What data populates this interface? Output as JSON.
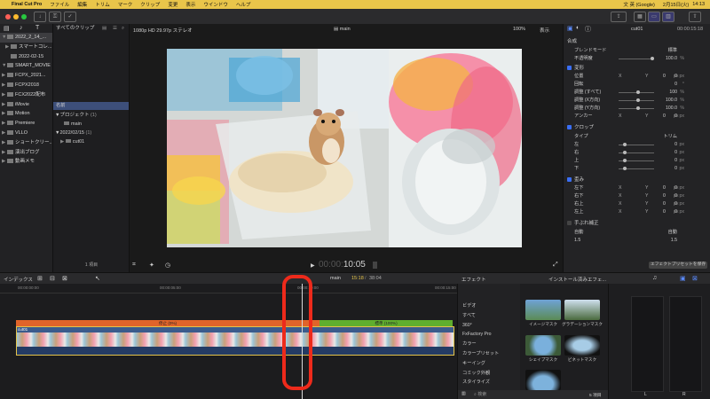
{
  "menubar": {
    "apple": "",
    "app": "Final Cut Pro",
    "items": [
      "ファイル",
      "編集",
      "トリム",
      "マーク",
      "クリップ",
      "変更",
      "表示",
      "ウインドウ",
      "ヘルプ"
    ],
    "input_method": "文 英 (Google)",
    "date": "2月15日(火)",
    "time": "14:13"
  },
  "sidebar": {
    "items": [
      {
        "label": "2022_2_14_...",
        "tri": "▼"
      },
      {
        "label": "スマートコレ...",
        "tri": "▶"
      },
      {
        "label": "2022-02-15",
        "tri": ""
      },
      {
        "label": "SMART_MOVIE",
        "tri": "▼"
      },
      {
        "label": "FCPX_2021...",
        "tri": "▶"
      },
      {
        "label": "FCPX2018",
        "tri": "▶"
      },
      {
        "label": "FCX2022配布",
        "tri": "▶"
      },
      {
        "label": "iMovie",
        "tri": "▶"
      },
      {
        "label": "Motion",
        "tri": "▶"
      },
      {
        "label": "Premiere",
        "tri": "▶"
      },
      {
        "label": "VLLO",
        "tri": "▶"
      },
      {
        "label": "ショートクリー...",
        "tri": "▶"
      },
      {
        "label": "演出ブログ",
        "tri": "▶"
      },
      {
        "label": "動画メモ",
        "tri": "▶"
      }
    ]
  },
  "browser": {
    "filter": "すべてのクリップ",
    "header": "名前",
    "rows": [
      {
        "label": "▼プロジェクト",
        "count": "(1)"
      },
      {
        "label": "main",
        "count": ""
      },
      {
        "label": "▼2022/02/15",
        "count": "(1)"
      },
      {
        "label": "cut01",
        "count": ""
      }
    ],
    "footer": "1 項目"
  },
  "viewer": {
    "format": "1080p HD 29.97p ステレオ",
    "project": "main",
    "zoom": "100%",
    "view": "表示",
    "timecode_dim": "00:00:",
    "timecode": "10:05"
  },
  "inspector": {
    "clip": "cut01",
    "duration": "00:00:15:18",
    "composite": "合成",
    "blend_label": "ブレンドモード",
    "blend_val": "標準",
    "opacity_label": "不透明度",
    "opacity_val": "100.0",
    "pct": "%",
    "transform": "変形",
    "position": "位置",
    "rotation": "回転",
    "scale_all": "調整 (すべて)",
    "scale_x": "調整 (X方向)",
    "scale_y": "調整 (Y方向)",
    "anchor": "アンカー",
    "x": "X",
    "y": "Y",
    "zero": "0",
    "px": "px",
    "deg": "°",
    "hundred": "100",
    "hundredf": "100.0",
    "crop": "クロップ",
    "type": "タイプ",
    "trim": "トリム",
    "left": "左",
    "right": "右",
    "top": "上",
    "bottom": "下",
    "distort": "歪み",
    "bl": "左下",
    "br": "右下",
    "tr": "右上",
    "tl": "左上",
    "rolling": "手ぶれ補正",
    "method": "自動",
    "amount": "1.5",
    "preset_btn": "エフェクトプリセットを保存"
  },
  "tlbar": {
    "index": "インデックス",
    "project": "main",
    "pos": "15:18",
    "total": "38:04",
    "effects": "エフェクト",
    "installed": "インストール済みエフェ..."
  },
  "timeline": {
    "ruler": [
      "00:00:00:00",
      "00:00:05:00",
      "00:00:10:00",
      "00:00:15:00"
    ],
    "speed1": "停止 (0%)",
    "speed2": "標準 (100%)",
    "clip": "cut01"
  },
  "effects": {
    "categories": [
      "ビデオ",
      "すべて",
      "360°",
      "FxFactory Pro",
      "カラー",
      "カラープリセット",
      "キーイング",
      "コミック外観",
      "スタイライズ"
    ],
    "thumbs": [
      "イメージマスク",
      "グラデーションマスク",
      "シェイプマスク",
      "ビネットマスク",
      ""
    ],
    "search": "検索",
    "count": "5 項目"
  },
  "meters": {
    "l": "L",
    "r": "R"
  },
  "colors": {
    "accent": "#3a6ef5",
    "menubar": "#e9c54a",
    "annot": "#ee2a1b",
    "speed_orange": "#e0642a",
    "speed_green": "#5fae2e"
  }
}
